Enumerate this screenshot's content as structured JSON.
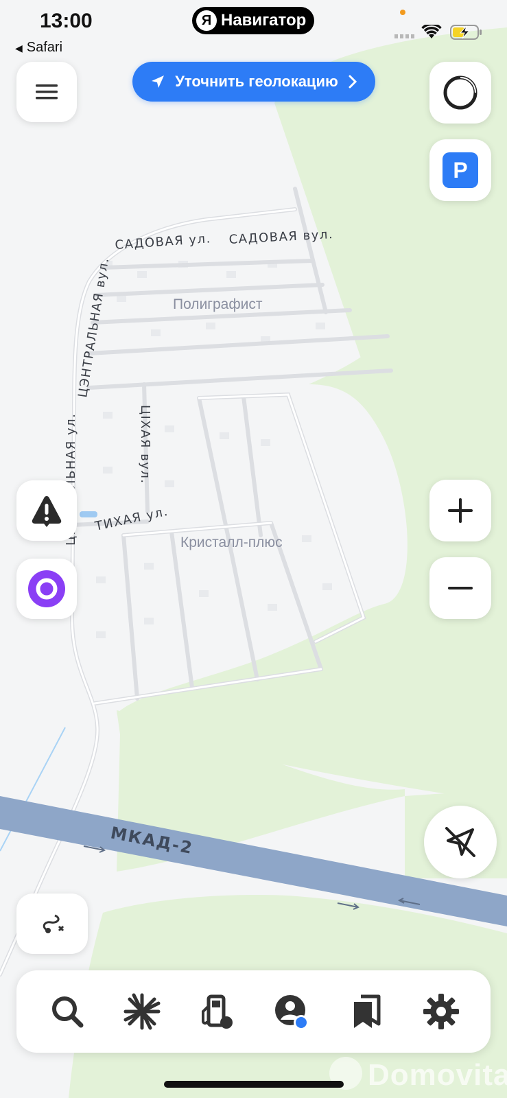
{
  "status_bar": {
    "time": "13:00",
    "back_app": "Safari",
    "app_badge_letter": "Я",
    "app_name": "Навигатор"
  },
  "geo_button": {
    "label": "Уточнить геолокацию"
  },
  "parking_button": {
    "label": "P"
  },
  "map": {
    "districts": [
      "Полиграфист",
      "Кристалл-плюс"
    ],
    "streets": {
      "sadovaya_1": "САДОВАЯ ул.",
      "sadovaya_2": "САДОВАЯ вул.",
      "centralnaya_by": "ЦЭНТРАЛЬНАЯ вул.",
      "centralnaya_ru": "ЦЕНТРАЛЬНАЯ ул.",
      "tikhaya_by": "ЦІХАЯ вул.",
      "tikhaya_ru": "ТИХАЯ ул."
    },
    "highway": "МКАД-2"
  },
  "watermark": "Domovita",
  "bottom_bar": {
    "items": [
      "search-icon",
      "discovery-icon",
      "gas-station-icon",
      "profile-icon",
      "bookmarks-icon",
      "settings-icon"
    ]
  },
  "colors": {
    "accent": "#2d7cf6",
    "park_green": "#e2f2d7",
    "highway": "#8ea6c8",
    "alice_purple": "#8a3ff5"
  }
}
